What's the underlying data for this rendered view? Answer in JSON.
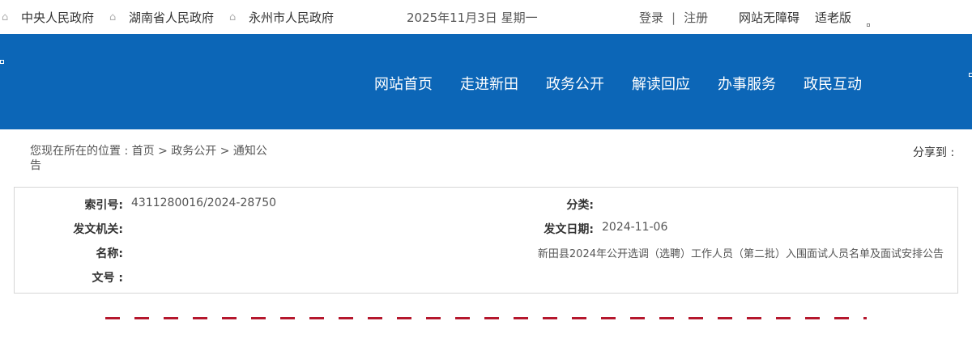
{
  "topbar": {
    "gov_links": [
      "中央人民政府",
      "湖南省人民政府",
      "永州市人民政府"
    ],
    "date": "2025年11月3日 星期一",
    "login": "登录",
    "separator": "|",
    "register": "注册",
    "accessibility": "网站无障碍",
    "elderly_mode": "适老版",
    "home_icon": "home-icon"
  },
  "nav": {
    "items": [
      "网站首页",
      "走进新田",
      "政务公开",
      "解读回应",
      "办事服务",
      "政民互动"
    ]
  },
  "breadcrumb": {
    "text": "您现在所在的位置 : 首页 > 政务公开 > 通知公告"
  },
  "share": {
    "label": "分享到 :"
  },
  "meta": {
    "index_label": "索引号:",
    "index_value": "4311280016/2024-28750",
    "category_label": "分类:",
    "category_value": "",
    "issuer_label": "发文机关:",
    "issuer_value": "",
    "date_label": "发文日期:",
    "date_value": "2024-11-06",
    "name_label": "名称:",
    "name_value": "新田县2024年公开选调（选聘）工作人员（第二批）入围面试人员名单及面试安排公告",
    "docno_label": "文号 :",
    "docno_value": ""
  },
  "colors": {
    "nav_background": "#0c66b7",
    "title_red": "#b5172d",
    "border": "#d6d6d6"
  }
}
